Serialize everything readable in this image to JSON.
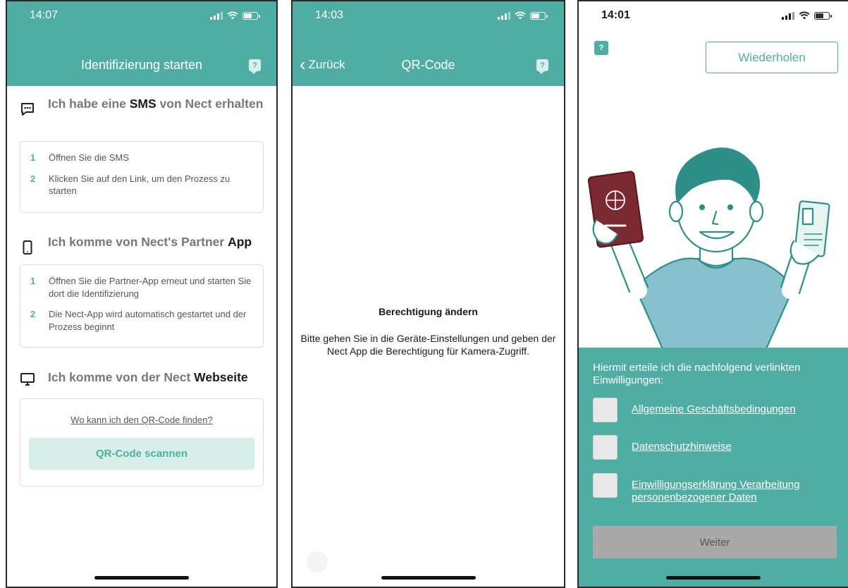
{
  "panel1": {
    "status_time": "14:07",
    "nav_title": "Identifizierung starten",
    "help_glyph": "?",
    "sms_section": {
      "title_pre": "Ich habe eine ",
      "title_bold": "SMS",
      "title_post": " von Nect erhalten",
      "icon": "chat-bubble-icon",
      "steps": [
        {
          "num": "1",
          "text": "Öffnen Sie die SMS"
        },
        {
          "num": "2",
          "text": "Klicken Sie auf den Link, um den Prozess zu starten"
        }
      ]
    },
    "app_section": {
      "title_pre": "Ich komme von Nect's Partner ",
      "title_bold": "App",
      "icon": "smartphone-icon",
      "steps": [
        {
          "num": "1",
          "text": "Öffnen Sie die Partner-App erneut und starten Sie dort die Identifizierung"
        },
        {
          "num": "2",
          "text": "Die Nect-App wird automatisch gestartet und der Prozess beginnt"
        }
      ]
    },
    "web_section": {
      "title_pre": "Ich komme von der Nect ",
      "title_bold": "Webseite",
      "icon": "monitor-icon",
      "link": "Wo kann ich den QR-Code finden?",
      "button": "QR-Code scannen"
    }
  },
  "panel2": {
    "status_time": "14:03",
    "back_label": "Zurück",
    "nav_title": "QR-Code",
    "help_glyph": "?",
    "perm_title": "Berechtigung ändern",
    "perm_text": "Bitte gehen Sie in die Geräte-Einstellungen und geben der Nect App die Berechtigung für Kamera-Zugriff."
  },
  "panel3": {
    "status_time": "14:01",
    "help_glyph": "?",
    "repeat_button": "Wiederholen",
    "illustration": "person-holding-passport-and-id-icon",
    "consent_intro": "Hiermit erteile ich die nachfolgend verlinkten Einwilligungen:",
    "consents": [
      {
        "label": "Allgemeine Geschäftsbedingungen",
        "checked": false
      },
      {
        "label": "Datenschutzhinweise",
        "checked": false
      },
      {
        "label": "Einwilligungserklärung Verarbeitung personenbezogener Daten",
        "checked": false
      }
    ],
    "continue_button": "Weiter"
  },
  "colors": {
    "brand_teal": "#4fada4",
    "light_teal": "#d7efe9",
    "disabled_gray": "#a9a9a9"
  }
}
